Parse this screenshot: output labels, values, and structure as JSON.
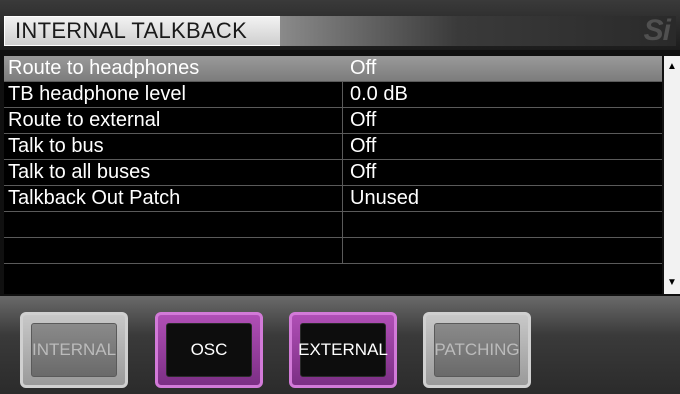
{
  "window": {
    "title": "INTERNAL TALKBACK",
    "brand_mark": "Si"
  },
  "table": {
    "rows": [
      {
        "label": "Route to headphones",
        "value": "Off",
        "selected": true
      },
      {
        "label": "TB headphone level",
        "value": " 0.0 dB",
        "selected": false
      },
      {
        "label": "Route to external",
        "value": "Off",
        "selected": false
      },
      {
        "label": "Talk to bus",
        "value": "Off",
        "selected": false
      },
      {
        "label": "Talk to all buses",
        "value": "Off",
        "selected": false
      },
      {
        "label": "Talkback Out Patch",
        "value": "Unused",
        "selected": false
      },
      {
        "label": "",
        "value": "",
        "selected": false
      },
      {
        "label": "",
        "value": "",
        "selected": false
      }
    ]
  },
  "scrollbar": {
    "up_glyph": "▲",
    "down_glyph": "▼"
  },
  "buttons": [
    {
      "label": "INTERNAL",
      "active": false
    },
    {
      "label": "OSC",
      "active": true
    },
    {
      "label": "EXTERNAL",
      "active": true
    },
    {
      "label": "PATCHING",
      "active": false
    }
  ],
  "colors": {
    "selection": "#8c8c8c",
    "accent": "#b04fb6"
  }
}
